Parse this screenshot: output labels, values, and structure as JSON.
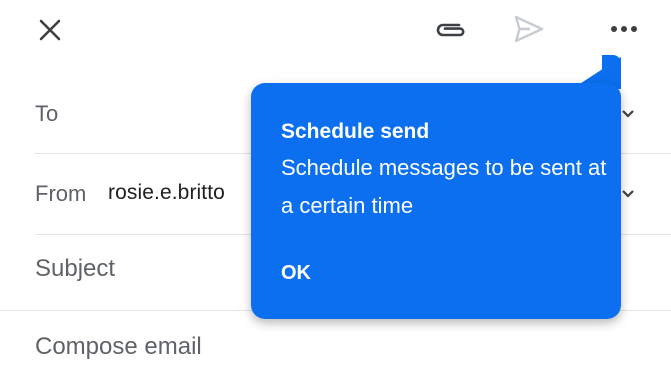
{
  "toolbar": {
    "close_icon": "close-icon",
    "attach_icon": "paperclip-icon",
    "send_icon": "send-icon",
    "more_icon": "more-options-icon"
  },
  "fields": {
    "to_label": "To",
    "from_label": "From",
    "from_value": "rosie.e.britto",
    "subject_placeholder": "Subject",
    "compose_placeholder": "Compose email"
  },
  "tooltip": {
    "title": "Schedule send",
    "body": "Schedule messages to be sent at a certain time",
    "ok_label": "OK"
  },
  "colors": {
    "tooltip_bg": "#0b6ff0",
    "icon_gray": "#5f6368",
    "send_disabled": "#c8ccd1",
    "divider": "#e3e3e3"
  }
}
